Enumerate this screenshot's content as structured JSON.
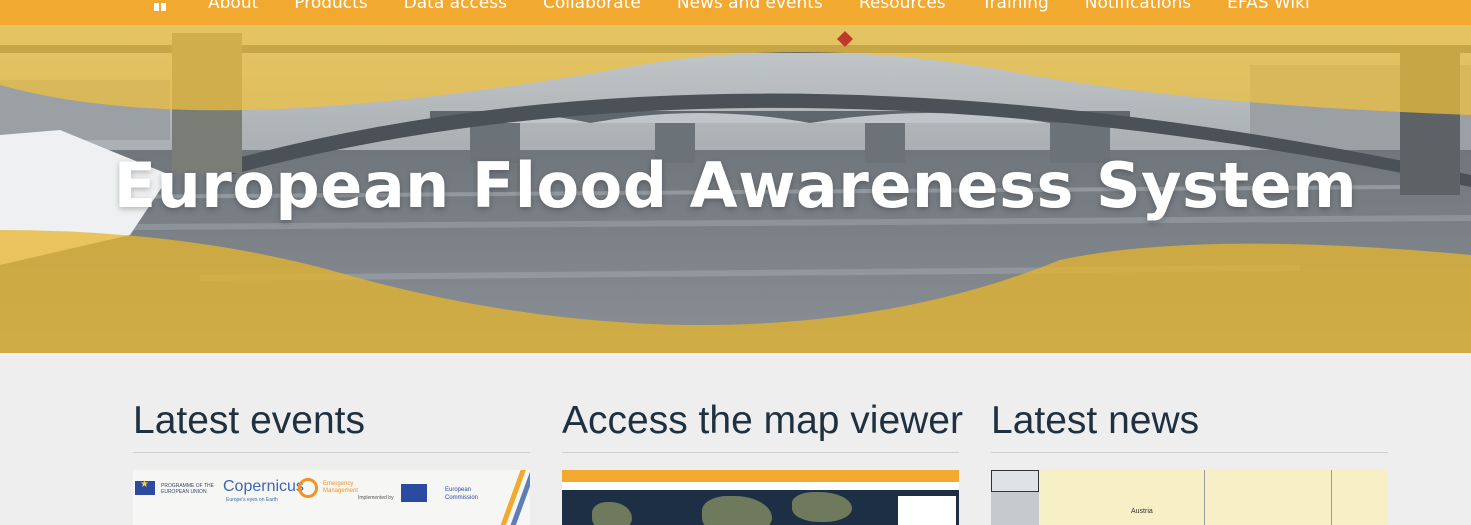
{
  "nav": {
    "home_icon": "home-icon",
    "items": [
      "About",
      "Products",
      "Data access",
      "Collaborate",
      "News and events",
      "Resources",
      "Training",
      "Notifications",
      "EFAS Wiki"
    ]
  },
  "hero": {
    "title": "European Flood Awareness System"
  },
  "columns": [
    {
      "heading": "Latest events",
      "thumb": {
        "programme_text": "PROGRAMME OF THE EUROPEAN UNION",
        "copernicus": "Copernicus",
        "copernicus_sub": "Europe's eyes on Earth",
        "em_text": "Emergency Management",
        "implemented_by": "Implemented by",
        "ec_text": "European Commission"
      }
    },
    {
      "heading": "Access the map viewer"
    },
    {
      "heading": "Latest news",
      "thumb": {
        "label": "Austria"
      }
    }
  ],
  "colors": {
    "nav_bg": "#f2a930",
    "heading": "#1f3140",
    "page_bg": "#eeeeee",
    "wave": "#f0c03a"
  }
}
